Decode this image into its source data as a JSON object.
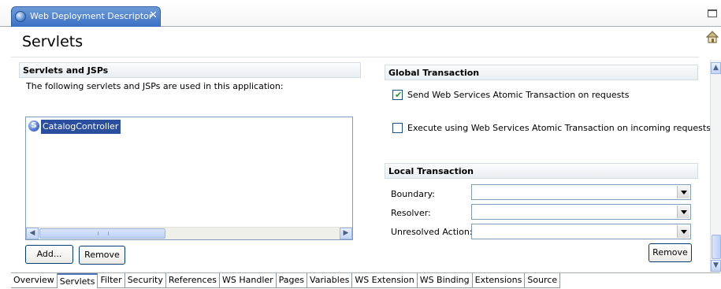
{
  "editor_tab": {
    "title": "Web Deployment Descriptor",
    "close": "✕"
  },
  "page": {
    "title": "Servlets"
  },
  "servlets_section": {
    "header": "Servlets and JSPs",
    "description": "The following servlets and JSPs are used in this application:",
    "items": [
      {
        "icon": "S",
        "label": "CatalogController",
        "selected": true
      }
    ],
    "add_label": "Add...",
    "remove_label": "Remove"
  },
  "global_transaction": {
    "header": "Global Transaction",
    "send_label": "Send Web Services Atomic Transaction on requests",
    "send_checked": true,
    "exec_label": "Execute using Web Services Atomic Transaction on incoming requests",
    "exec_checked": false
  },
  "local_transaction": {
    "header": "Local Transaction",
    "boundary_label": "Boundary:",
    "boundary_value": "",
    "resolver_label": "Resolver:",
    "resolver_value": "",
    "unresolved_label": "Unresolved Action:",
    "unresolved_value": "",
    "remove_label": "Remove"
  },
  "page_tabs": {
    "active": "Servlets",
    "labels": [
      "Overview",
      "Servlets",
      "Filter",
      "Security",
      "References",
      "WS Handler",
      "Pages",
      "Variables",
      "WS Extension",
      "WS Binding",
      "Extensions",
      "Source"
    ]
  },
  "icons": {
    "globe": "globe-icon",
    "home": "home-icon",
    "servlet": "servlet-icon",
    "check": "✔"
  },
  "colors": {
    "tab_active": "#3a6fc5",
    "selection": "#2b4f9e",
    "border": "#7f9db9"
  }
}
